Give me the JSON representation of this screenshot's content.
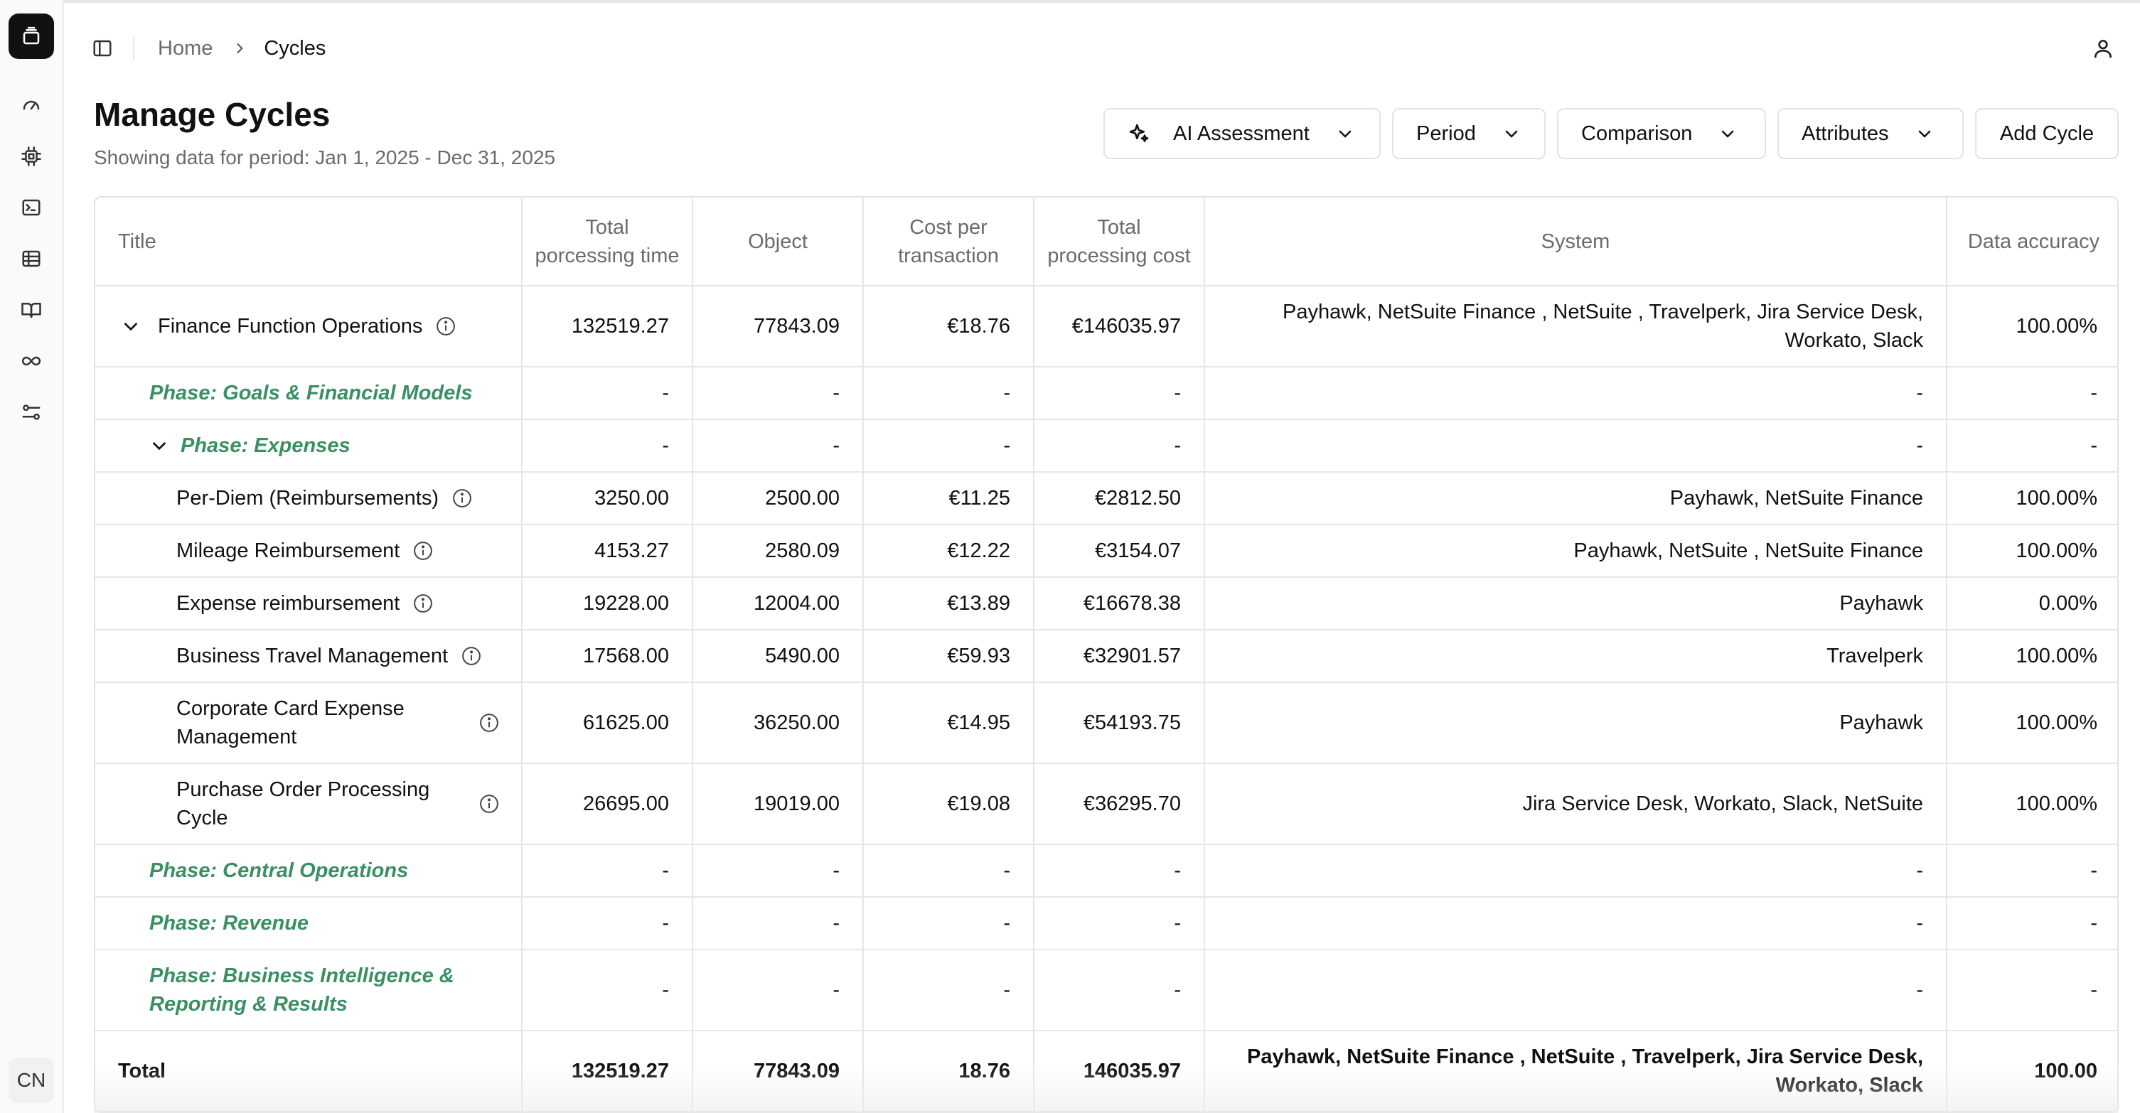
{
  "sidebar": {
    "avatar_initials": "CN",
    "icons": [
      "dashboard-icon",
      "cpu-icon",
      "terminal-icon",
      "table-icon",
      "book-icon",
      "infinity-icon",
      "sliders-icon"
    ]
  },
  "header": {
    "breadcrumb": {
      "home": "Home",
      "current": "Cycles"
    }
  },
  "page": {
    "title": "Manage Cycles",
    "subtitle": "Showing data for period: Jan 1, 2025 - Dec 31, 2025"
  },
  "toolbar": {
    "ai_assessment": "AI Assessment",
    "period": "Period",
    "comparison": "Comparison",
    "attributes": "Attributes",
    "add_cycle": "Add Cycle"
  },
  "table": {
    "columns": {
      "title": "Title",
      "total_processing_time": "Total porcessing time",
      "object": "Object",
      "cost_per_transaction": "Cost per transaction",
      "total_processing_cost": "Total processing cost",
      "system": "System",
      "data_accuracy": "Data accuracy"
    },
    "finance": {
      "title": "Finance Function Operations",
      "time": "132519.27",
      "object": "77843.09",
      "cpt": "€18.76",
      "cost": "€146035.97",
      "system": "Payhawk, NetSuite Finance , NetSuite , Travelperk, Jira Service Desk, Workato, Slack",
      "accuracy": "100.00%"
    },
    "phases": {
      "goals": "Phase: Goals & Financial Models",
      "expenses": "Phase: Expenses",
      "central": "Phase: Central Operations",
      "revenue": "Phase: Revenue",
      "bi": "Phase: Business Intelligence & Reporting & Results"
    },
    "dash": "-",
    "items": [
      {
        "title": "Per-Diem (Reimbursements)",
        "time": "3250.00",
        "object": "2500.00",
        "cpt": "€11.25",
        "cost": "€2812.50",
        "system": "Payhawk, NetSuite Finance",
        "accuracy": "100.00%"
      },
      {
        "title": "Mileage Reimbursement",
        "time": "4153.27",
        "object": "2580.09",
        "cpt": "€12.22",
        "cost": "€3154.07",
        "system": "Payhawk, NetSuite , NetSuite Finance",
        "accuracy": "100.00%"
      },
      {
        "title": "Expense reimbursement",
        "time": "19228.00",
        "object": "12004.00",
        "cpt": "€13.89",
        "cost": "€16678.38",
        "system": "Payhawk",
        "accuracy": "0.00%"
      },
      {
        "title": "Business Travel Management",
        "time": "17568.00",
        "object": "5490.00",
        "cpt": "€59.93",
        "cost": "€32901.57",
        "system": "Travelperk",
        "accuracy": "100.00%"
      },
      {
        "title": "Corporate Card Expense Management",
        "time": "61625.00",
        "object": "36250.00",
        "cpt": "€14.95",
        "cost": "€54193.75",
        "system": "Payhawk",
        "accuracy": "100.00%"
      },
      {
        "title": "Purchase Order Processing Cycle",
        "time": "26695.00",
        "object": "19019.00",
        "cpt": "€19.08",
        "cost": "€36295.70",
        "system": "Jira Service Desk, Workato, Slack, NetSuite",
        "accuracy": "100.00%"
      }
    ],
    "total": {
      "title": "Total",
      "time": "132519.27",
      "object": "77843.09",
      "cpt": "18.76",
      "cost": "146035.97",
      "system": "Payhawk, NetSuite Finance , NetSuite , Travelperk, Jira Service Desk, Workato, Slack",
      "accuracy": "100.00"
    }
  },
  "colors": {
    "phase_green": "#3a8f63",
    "muted_text": "#6b6b6b",
    "border": "#e6e6e6"
  }
}
